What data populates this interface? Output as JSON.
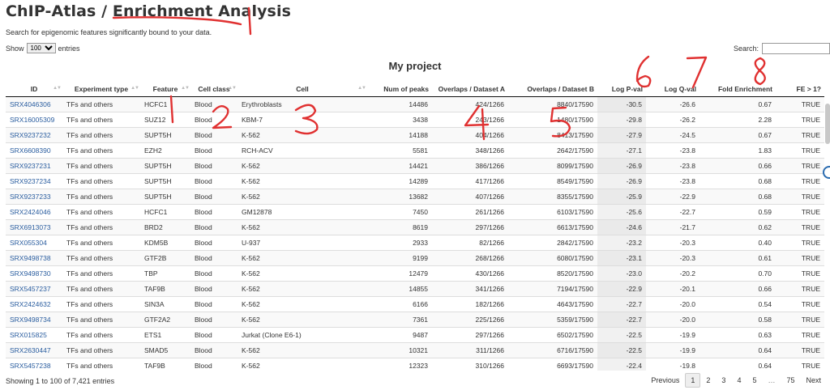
{
  "header": {
    "title": "ChIP-Atlas / Enrichment Analysis",
    "subtitle": "Search for epigenomic features significantly bound to your data."
  },
  "controls": {
    "show_label": "Show",
    "show_value": "100",
    "entries_label": "entries",
    "search_label": "Search:"
  },
  "project_title": "My project",
  "table": {
    "columns": [
      "ID",
      "Experiment type",
      "Feature",
      "Cell class",
      "Cell",
      "Num of peaks",
      "Overlaps / Dataset A",
      "Overlaps / Dataset B",
      "Log P-val",
      "Log Q-val",
      "Fold Enrichment",
      "FE > 1?"
    ],
    "rows": [
      [
        "SRX4046306",
        "TFs and others",
        "HCFC1",
        "Blood",
        "Erythroblasts",
        "14486",
        "424/1266",
        "8840/17590",
        "-30.5",
        "-26.6",
        "0.67",
        "TRUE"
      ],
      [
        "SRX16005309",
        "TFs and others",
        "SUZ12",
        "Blood",
        "KBM-7",
        "3438",
        "243/1266",
        "1480/17590",
        "-29.8",
        "-26.2",
        "2.28",
        "TRUE"
      ],
      [
        "SRX9237232",
        "TFs and others",
        "SUPT5H",
        "Blood",
        "K-562",
        "14188",
        "404/1266",
        "8413/17590",
        "-27.9",
        "-24.5",
        "0.67",
        "TRUE"
      ],
      [
        "SRX6608390",
        "TFs and others",
        "EZH2",
        "Blood",
        "RCH-ACV",
        "5581",
        "348/1266",
        "2642/17590",
        "-27.1",
        "-23.8",
        "1.83",
        "TRUE"
      ],
      [
        "SRX9237231",
        "TFs and others",
        "SUPT5H",
        "Blood",
        "K-562",
        "14421",
        "386/1266",
        "8099/17590",
        "-26.9",
        "-23.8",
        "0.66",
        "TRUE"
      ],
      [
        "SRX9237234",
        "TFs and others",
        "SUPT5H",
        "Blood",
        "K-562",
        "14289",
        "417/1266",
        "8549/17590",
        "-26.9",
        "-23.8",
        "0.68",
        "TRUE"
      ],
      [
        "SRX9237233",
        "TFs and others",
        "SUPT5H",
        "Blood",
        "K-562",
        "13682",
        "407/1266",
        "8355/17590",
        "-25.9",
        "-22.9",
        "0.68",
        "TRUE"
      ],
      [
        "SRX2424046",
        "TFs and others",
        "HCFC1",
        "Blood",
        "GM12878",
        "7450",
        "261/1266",
        "6103/17590",
        "-25.6",
        "-22.7",
        "0.59",
        "TRUE"
      ],
      [
        "SRX6913073",
        "TFs and others",
        "BRD2",
        "Blood",
        "K-562",
        "8619",
        "297/1266",
        "6613/17590",
        "-24.6",
        "-21.7",
        "0.62",
        "TRUE"
      ],
      [
        "SRX055304",
        "TFs and others",
        "KDM5B",
        "Blood",
        "U-937",
        "2933",
        "82/1266",
        "2842/17590",
        "-23.2",
        "-20.3",
        "0.40",
        "TRUE"
      ],
      [
        "SRX9498738",
        "TFs and others",
        "GTF2B",
        "Blood",
        "K-562",
        "9199",
        "268/1266",
        "6080/17590",
        "-23.1",
        "-20.3",
        "0.61",
        "TRUE"
      ],
      [
        "SRX9498730",
        "TFs and others",
        "TBP",
        "Blood",
        "K-562",
        "12479",
        "430/1266",
        "8520/17590",
        "-23.0",
        "-20.2",
        "0.70",
        "TRUE"
      ],
      [
        "SRX5457237",
        "TFs and others",
        "TAF9B",
        "Blood",
        "K-562",
        "14855",
        "341/1266",
        "7194/17590",
        "-22.9",
        "-20.1",
        "0.66",
        "TRUE"
      ],
      [
        "SRX2424632",
        "TFs and others",
        "SIN3A",
        "Blood",
        "K-562",
        "6166",
        "182/1266",
        "4643/17590",
        "-22.7",
        "-20.0",
        "0.54",
        "TRUE"
      ],
      [
        "SRX9498734",
        "TFs and others",
        "GTF2A2",
        "Blood",
        "K-562",
        "7361",
        "225/1266",
        "5359/17590",
        "-22.7",
        "-20.0",
        "0.58",
        "TRUE"
      ],
      [
        "SRX015825",
        "TFs and others",
        "ETS1",
        "Blood",
        "Jurkat (Clone E6-1)",
        "9487",
        "297/1266",
        "6502/17590",
        "-22.5",
        "-19.9",
        "0.63",
        "TRUE"
      ],
      [
        "SRX2630447",
        "TFs and others",
        "SMAD5",
        "Blood",
        "K-562",
        "10321",
        "311/1266",
        "6716/17590",
        "-22.5",
        "-19.9",
        "0.64",
        "TRUE"
      ],
      [
        "SRX5457238",
        "TFs and others",
        "TAF9B",
        "Blood",
        "K-562",
        "12323",
        "310/1266",
        "6693/17590",
        "-22.4",
        "-19.8",
        "0.64",
        "TRUE"
      ]
    ]
  },
  "footer": {
    "info": "Showing 1 to 100 of 7,421 entries",
    "previous": "Previous",
    "pages": [
      "1",
      "2",
      "3",
      "4",
      "5"
    ],
    "ellipsis": "…",
    "last": "75",
    "next": "Next"
  },
  "annotations": {
    "color": "#e03131",
    "numbers": [
      "1",
      "2",
      "3",
      "4",
      "5",
      "6",
      "7",
      "8"
    ]
  }
}
